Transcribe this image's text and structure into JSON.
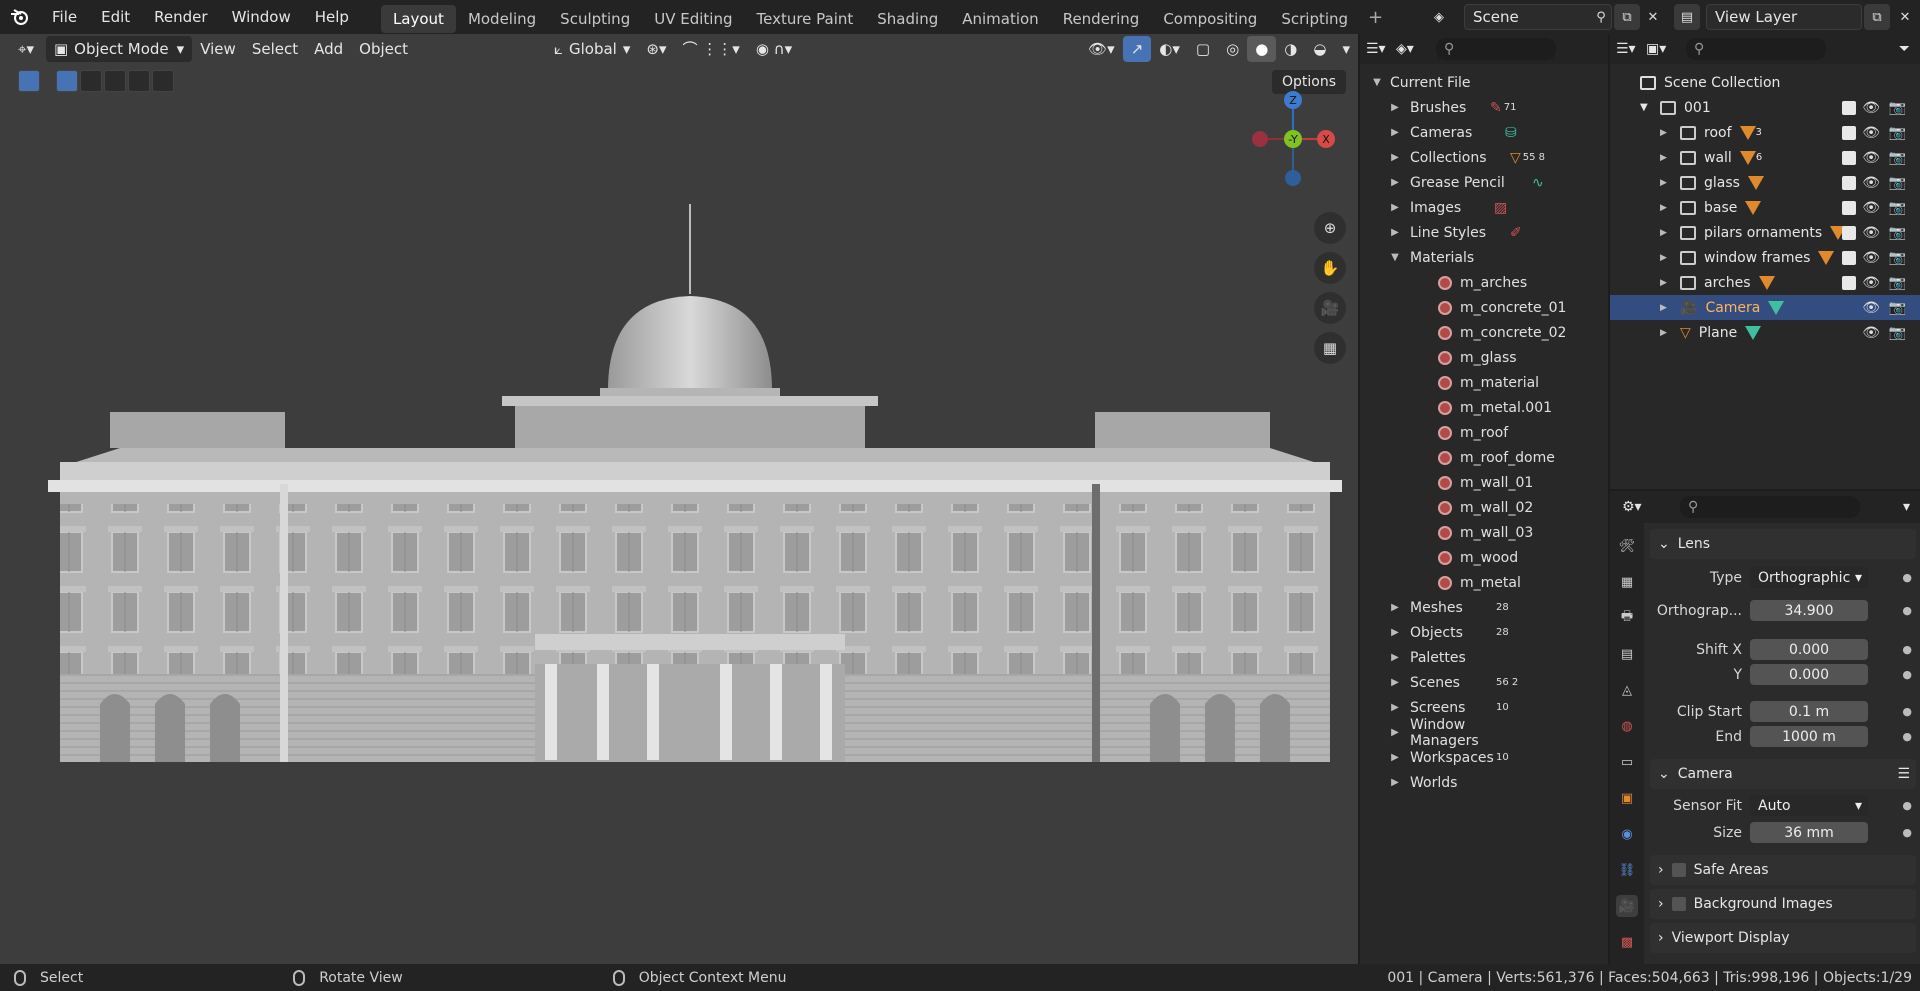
{
  "topbar": {
    "menus": [
      "File",
      "Edit",
      "Render",
      "Window",
      "Help"
    ],
    "workspaces": [
      "Layout",
      "Modeling",
      "Sculpting",
      "UV Editing",
      "Texture Paint",
      "Shading",
      "Animation",
      "Rendering",
      "Compositing",
      "Scripting"
    ],
    "active_workspace": "Layout",
    "scene_name": "Scene",
    "view_layer": "View Layer"
  },
  "viewport": {
    "header": {
      "mode": "Object Mode",
      "menus": [
        "View",
        "Select",
        "Add",
        "Object"
      ],
      "transform_orientation": "Global"
    },
    "options_label": "Options",
    "gizmo": {
      "z": "Z",
      "y": "-Y",
      "x": "X"
    }
  },
  "outliner_file": {
    "root": "Current File",
    "items": [
      {
        "label": "Brushes",
        "badge": "71"
      },
      {
        "label": "Cameras",
        "badge": ""
      },
      {
        "label": "Collections",
        "badge": "55  8"
      },
      {
        "label": "Grease Pencil",
        "badge": ""
      },
      {
        "label": "Images",
        "badge": ""
      },
      {
        "label": "Line Styles",
        "badge": ""
      },
      {
        "label": "Materials",
        "badge": ""
      }
    ],
    "materials": [
      "m_arches",
      "m_concrete_01",
      "m_concrete_02",
      "m_glass",
      "m_material",
      "m_metal.001",
      "m_roof",
      "m_roof_dome",
      "m_wall_01",
      "m_wall_02",
      "m_wall_03",
      "m_wood",
      "m_metal"
    ],
    "items_after": [
      {
        "label": "Meshes",
        "badge": "28"
      },
      {
        "label": "Objects",
        "badge": "28"
      },
      {
        "label": "Palettes",
        "badge": ""
      },
      {
        "label": "Scenes",
        "badge": "56  2"
      },
      {
        "label": "Screens",
        "badge": "10"
      },
      {
        "label": "Window Managers",
        "badge": ""
      },
      {
        "label": "Workspaces",
        "badge": "10"
      },
      {
        "label": "Worlds",
        "badge": ""
      }
    ]
  },
  "outliner_scene": {
    "root": "Scene Collection",
    "collection": "001",
    "children": [
      {
        "label": "roof",
        "badge": "3"
      },
      {
        "label": "wall",
        "badge": "6"
      },
      {
        "label": "glass",
        "badge": ""
      },
      {
        "label": "base",
        "badge": ""
      },
      {
        "label": "pilars ornaments",
        "badge": ""
      },
      {
        "label": "window frames",
        "badge": ""
      },
      {
        "label": "arches",
        "badge": ""
      }
    ],
    "objects": [
      {
        "label": "Camera"
      },
      {
        "label": "Plane"
      }
    ]
  },
  "properties": {
    "lens_panel": "Lens",
    "type_label": "Type",
    "type_value": "Orthographic",
    "ortho_label": "Orthograp...",
    "ortho_value": "34.900",
    "shiftx_label": "Shift X",
    "shiftx_value": "0.000",
    "shifty_label": "Y",
    "shifty_value": "0.000",
    "clipstart_label": "Clip Start",
    "clipstart_value": "0.1 m",
    "clipend_label": "End",
    "clipend_value": "1000 m",
    "camera_panel": "Camera",
    "sensorfit_label": "Sensor Fit",
    "sensorfit_value": "Auto",
    "size_label": "Size",
    "size_value": "36 mm",
    "safe_areas": "Safe Areas",
    "bg_images": "Background Images",
    "viewport_display": "Viewport Display"
  },
  "statusbar": {
    "select": "Select",
    "rotate": "Rotate View",
    "context": "Object Context Menu",
    "stats": "001 | Camera | Verts:561,376 | Faces:504,663 | Tris:998,196 | Objects:1/29"
  }
}
